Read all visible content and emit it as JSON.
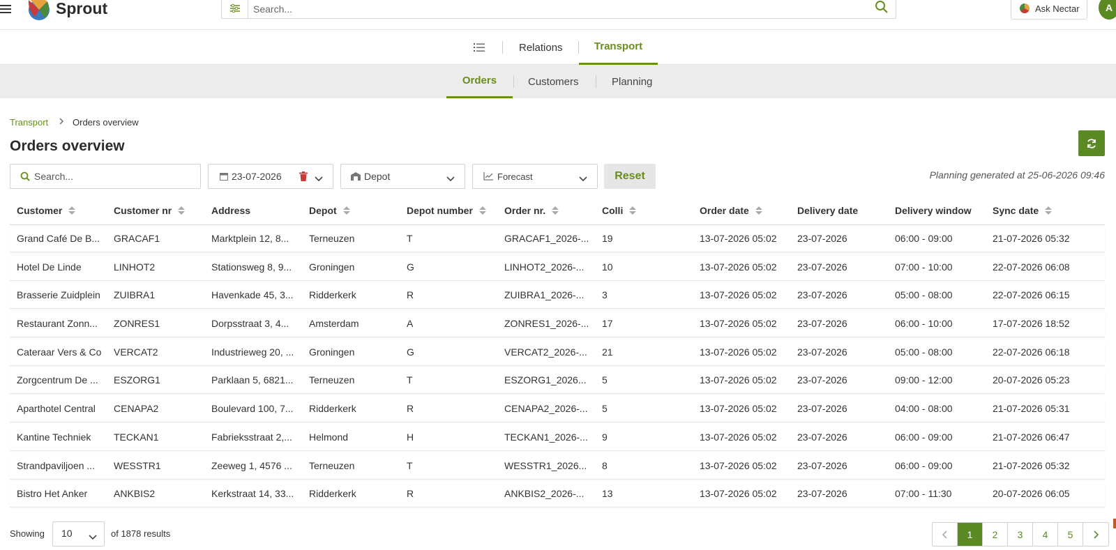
{
  "app": {
    "brand": "Sprout"
  },
  "top_search": {
    "placeholder": "Search..."
  },
  "ask_nectar": {
    "label": "Ask Nectar"
  },
  "avatar": {
    "initial": "A"
  },
  "module_tabs": [
    {
      "label": "Relations",
      "active": false
    },
    {
      "label": "Transport",
      "active": true
    }
  ],
  "sub_tabs": [
    {
      "label": "Orders",
      "active": true
    },
    {
      "label": "Customers",
      "active": false
    },
    {
      "label": "Planning",
      "active": false
    }
  ],
  "breadcrumb": {
    "parent": "Transport",
    "current": "Orders overview"
  },
  "page_title": "Orders overview",
  "filters": {
    "search_placeholder": "Search...",
    "date": "23-07-2026",
    "depot": "Depot",
    "forecast": "Forecast",
    "reset": "Reset"
  },
  "planning_generated": "Planning generated at 25-06-2026 09:46",
  "table": {
    "columns": [
      {
        "label": "Customer",
        "sortable": true
      },
      {
        "label": "Customer nr",
        "sortable": true
      },
      {
        "label": "Address",
        "sortable": false
      },
      {
        "label": "Depot",
        "sortable": true
      },
      {
        "label": "Depot number",
        "sortable": true
      },
      {
        "label": "Order nr.",
        "sortable": true
      },
      {
        "label": "Colli",
        "sortable": true
      },
      {
        "label": "Order date",
        "sortable": true
      },
      {
        "label": "Delivery date",
        "sortable": false
      },
      {
        "label": "Delivery window",
        "sortable": false
      },
      {
        "label": "Sync date",
        "sortable": true
      }
    ],
    "rows": [
      [
        "Grand Café De B...",
        "GRACAF1",
        "Marktplein 12, 8...",
        "Terneuzen",
        "T",
        "GRACAF1_2026-...",
        "19",
        "13-07-2026 05:02",
        "23-07-2026",
        "06:00 - 09:00",
        "21-07-2026 05:32"
      ],
      [
        "Hotel De Linde",
        "LINHOT2",
        "Stationsweg 8, 9...",
        "Groningen",
        "G",
        "LINHOT2_2026-...",
        "10",
        "13-07-2026 05:02",
        "23-07-2026",
        "07:00 - 10:00",
        "22-07-2026 06:08"
      ],
      [
        "Brasserie Zuidplein",
        "ZUIBRA1",
        "Havenkade 45, 3...",
        "Ridderkerk",
        "R",
        "ZUIBRA1_2026-...",
        "3",
        "13-07-2026 05:02",
        "23-07-2026",
        "05:00 - 08:00",
        "22-07-2026 06:15"
      ],
      [
        "Restaurant Zonn...",
        "ZONRES1",
        "Dorpsstraat 3, 4...",
        "Amsterdam",
        "A",
        "ZONRES1_2026-...",
        "17",
        "13-07-2026 05:02",
        "23-07-2026",
        "06:00 - 10:00",
        "17-07-2026 18:52"
      ],
      [
        "Cateraar Vers & Co",
        "VERCAT2",
        "Industrieweg 20, ...",
        "Groningen",
        "G",
        "VERCAT2_2026-...",
        "21",
        "13-07-2026 05:02",
        "23-07-2026",
        "05:00 - 08:00",
        "22-07-2026 06:18"
      ],
      [
        "Zorgcentrum De ...",
        "ESZORG1",
        "Parklaan 5, 6821...",
        "Terneuzen",
        "T",
        "ESZORG1_2026...",
        "5",
        "13-07-2026 05:02",
        "23-07-2026",
        "09:00 - 12:00",
        "20-07-2026 05:23"
      ],
      [
        "Aparthotel Central",
        "CENAPA2",
        "Boulevard 100, 7...",
        "Ridderkerk",
        "R",
        "CENAPA2_2026-...",
        "5",
        "13-07-2026 05:02",
        "23-07-2026",
        "04:00 - 08:00",
        "21-07-2026 05:31"
      ],
      [
        "Kantine Techniek",
        "TECKAN1",
        "Fabrieksstraat 2,...",
        "Helmond",
        "H",
        "TECKAN1_2026-...",
        "9",
        "13-07-2026 05:02",
        "23-07-2026",
        "06:00 - 09:00",
        "21-07-2026 06:47"
      ],
      [
        "Strandpaviljoen ...",
        "WESSTR1",
        "Zeeweg 1, 4576 ...",
        "Terneuzen",
        "T",
        "WESSTR1_2026...",
        "8",
        "13-07-2026 05:02",
        "23-07-2026",
        "06:00 - 09:00",
        "21-07-2026 05:32"
      ],
      [
        "Bistro Het Anker",
        "ANKBIS2",
        "Kerkstraat 14, 33...",
        "Ridderkerk",
        "R",
        "ANKBIS2_2026-...",
        "13",
        "13-07-2026 05:02",
        "23-07-2026",
        "07:00 - 11:30",
        "20-07-2026 06:05"
      ]
    ]
  },
  "footer": {
    "showing_label": "Showing",
    "page_size": "10",
    "results_text": "of 1878 results",
    "pages": [
      "1",
      "2",
      "3",
      "4",
      "5"
    ],
    "current_page": "1"
  },
  "colors": {
    "accent": "#6a8e1a",
    "accent_button": "#5b8a25"
  }
}
